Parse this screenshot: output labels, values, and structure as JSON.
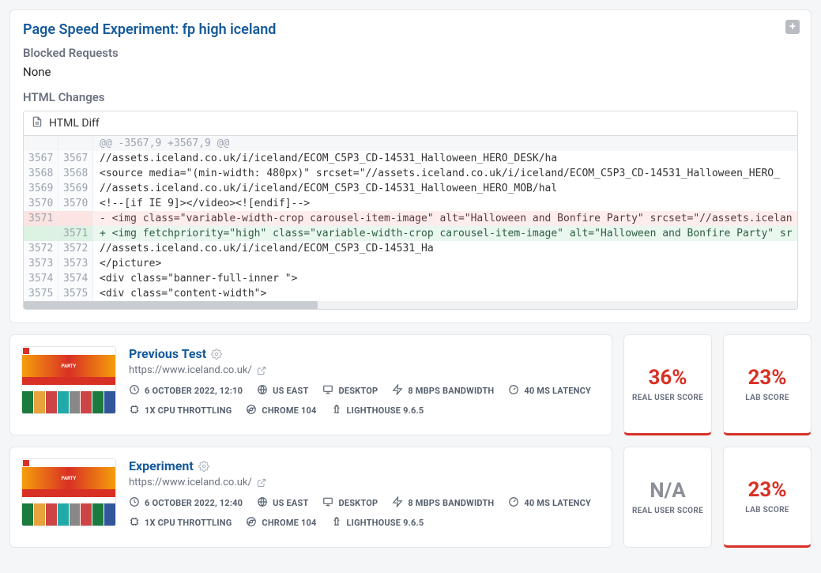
{
  "experiment": {
    "title": "Page Speed Experiment: fp high iceland",
    "blocked_label": "Blocked Requests",
    "blocked_value": "None",
    "changes_label": "HTML Changes",
    "diff_title": "HTML Diff"
  },
  "diff": {
    "hunk": "@@ -3567,9 +3567,9 @@",
    "rows": [
      {
        "l": "3567",
        "r": "3567",
        "t": "ctx",
        "c": "                                    //assets.iceland.co.uk/i/iceland/ECOM_C5P3_CD-14531_Halloween_HERO_DESK/ha"
      },
      {
        "l": "3568",
        "r": "3568",
        "t": "ctx",
        "c": "  <source media=\"(min-width: 480px)\" srcset=\"//assets.iceland.co.uk/i/iceland/ECOM_C5P3_CD-14531_Halloween_HERO_"
      },
      {
        "l": "3569",
        "r": "3569",
        "t": "ctx",
        "c": "                                    //assets.iceland.co.uk/i/iceland/ECOM_C5P3_CD-14531_Halloween_HERO_MOB/hal"
      },
      {
        "l": "3570",
        "r": "3570",
        "t": "ctx",
        "c": "  <!--[if IE 9]></video><![endif]-->"
      },
      {
        "l": "3571",
        "r": "",
        "t": "del",
        "c": "- <img class=\"variable-width-crop carousel-item-image\" alt=\"Halloween and Bonfire Party\" srcset=\"//assets.icelan"
      },
      {
        "l": "",
        "r": "3571",
        "t": "add",
        "c": "+ <img fetchpriority=\"high\" class=\"variable-width-crop carousel-item-image\" alt=\"Halloween and Bonfire Party\" sr"
      },
      {
        "l": "3572",
        "r": "3572",
        "t": "ctx",
        "c": "                                                      //assets.iceland.co.uk/i/iceland/ECOM_C5P3_CD-14531_Ha"
      },
      {
        "l": "3573",
        "r": "3573",
        "t": "ctx",
        "c": "  </picture>"
      },
      {
        "l": "3574",
        "r": "3574",
        "t": "ctx",
        "c": "  <div class=\"banner-full-inner \">"
      },
      {
        "l": "3575",
        "r": "3575",
        "t": "ctx",
        "c": "  <div class=\"content-width\">"
      }
    ]
  },
  "tests": [
    {
      "title": "Previous Test",
      "url": "https://www.iceland.co.uk/",
      "meta": {
        "date": "6 OCTOBER 2022, 12:10",
        "region": "US EAST",
        "device": "DESKTOP",
        "bandwidth": "8 MBPS BANDWIDTH",
        "latency": "40 MS LATENCY",
        "throttling": "1X CPU THROTTLING",
        "browser": "CHROME 104",
        "lighthouse": "LIGHTHOUSE 9.6.5"
      },
      "real_user_score": "36%",
      "real_user_na": false,
      "lab_score": "23%"
    },
    {
      "title": "Experiment",
      "url": "https://www.iceland.co.uk/",
      "meta": {
        "date": "6 OCTOBER 2022, 12:40",
        "region": "US EAST",
        "device": "DESKTOP",
        "bandwidth": "8 MBPS BANDWIDTH",
        "latency": "40 MS LATENCY",
        "throttling": "1X CPU THROTTLING",
        "browser": "CHROME 104",
        "lighthouse": "LIGHTHOUSE 9.6.5"
      },
      "real_user_score": "N/A",
      "real_user_na": true,
      "lab_score": "23%"
    }
  ],
  "labels": {
    "real_user": "REAL USER SCORE",
    "lab": "LAB SCORE"
  }
}
